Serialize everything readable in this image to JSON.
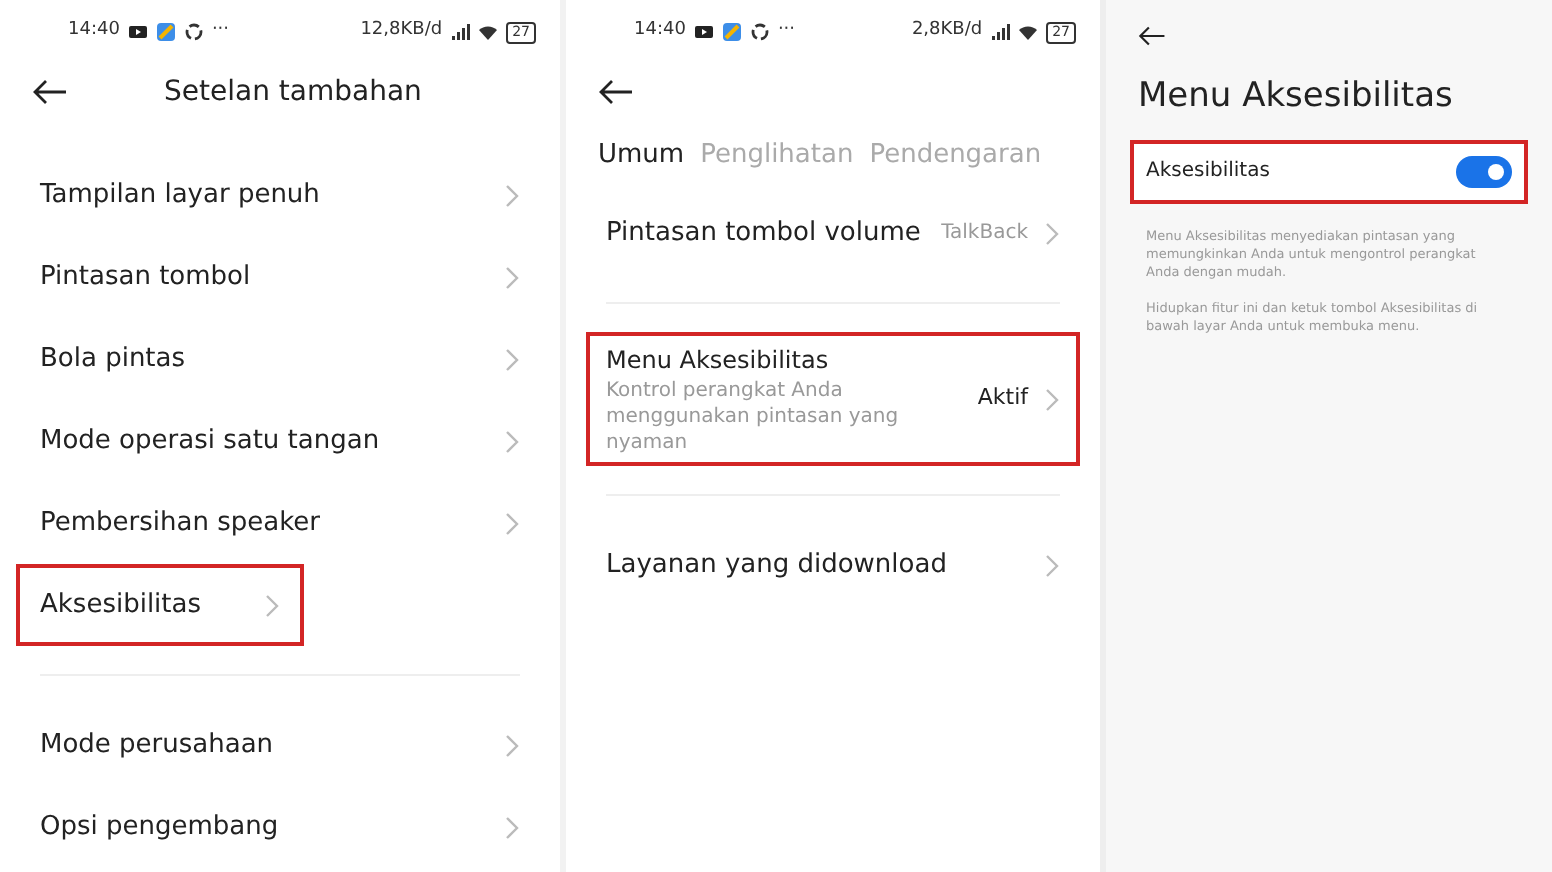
{
  "screens": [
    {
      "status_bar": {
        "time": "14:40",
        "more": "···",
        "speed": "12,8KB/d",
        "battery": "27"
      },
      "title": "Setelan tambahan",
      "groups": [
        [
          {
            "label": "Tampilan layar penuh",
            "highlighted": false
          },
          {
            "label": "Pintasan tombol",
            "highlighted": false
          },
          {
            "label": "Bola pintas",
            "highlighted": false
          },
          {
            "label": "Mode operasi satu tangan",
            "highlighted": false
          },
          {
            "label": "Pembersihan speaker",
            "highlighted": false
          },
          {
            "label": "Aksesibilitas",
            "highlighted": true
          }
        ],
        [
          {
            "label": "Mode perusahaan",
            "highlighted": false
          },
          {
            "label": "Opsi pengembang",
            "highlighted": false
          }
        ]
      ]
    },
    {
      "status_bar": {
        "time": "14:40",
        "more": "···",
        "speed": "2,8KB/d",
        "battery": "27"
      },
      "tabs": [
        {
          "label": "Umum",
          "selected": true
        },
        {
          "label": "Penglihatan",
          "selected": false
        },
        {
          "label": "Pendengaran",
          "selected": false
        }
      ],
      "groups": [
        [
          {
            "label": "Pintasan tombol volume",
            "value": "TalkBack",
            "highlighted": false
          }
        ],
        [
          {
            "label": "Menu Aksesibilitas",
            "description": "Kontrol perangkat Anda menggunakan pintasan yang nyaman",
            "value": "Aktif",
            "highlighted": true
          }
        ],
        [
          {
            "label": "Layanan yang didownload",
            "highlighted": false
          }
        ]
      ]
    },
    {
      "title": "Menu Aksesibilitas",
      "toggle": {
        "label": "Aksesibilitas",
        "on": true,
        "highlighted": true
      },
      "paragraphs": [
        "Menu Aksesibilitas menyediakan pintasan yang memungkinkan Anda untuk mengontrol perangkat Anda dengan mudah.",
        "Hidupkan fitur ini dan ketuk tombol Aksesibilitas di bawah layar Anda untuk membuka menu."
      ]
    }
  ]
}
